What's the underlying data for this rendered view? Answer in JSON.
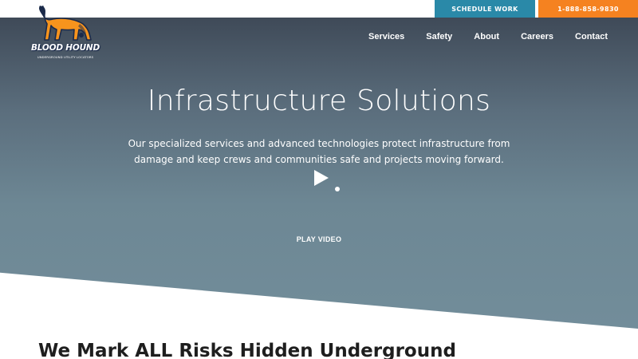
{
  "topbar": {
    "schedule_label": "SCHEDULE WORK",
    "phone_label": "1-888-858-9830",
    "schedule_color": "#2a89a8",
    "phone_color": "#f58220"
  },
  "logo": {
    "name": "BLOOD HOUND",
    "tagline": "UNDERGROUND UTILITY LOCATORS",
    "icon": "hound-dog-icon"
  },
  "nav": {
    "items": [
      "Services",
      "Safety",
      "About",
      "Careers",
      "Contact"
    ]
  },
  "hero": {
    "title": "Infrastructure Solutions",
    "subtitle_line1": "Our specialized services and advanced technologies protect infrastructure from",
    "subtitle_line2": "damage and keep crews and communities safe and projects moving forward.",
    "play_label": "PLAY VIDEO",
    "play_icon": "play-icon"
  },
  "section": {
    "title": "We Mark ALL Risks Hidden Underground"
  }
}
